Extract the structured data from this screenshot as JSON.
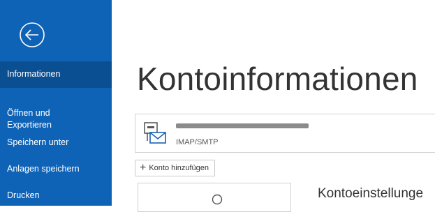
{
  "sidebar": {
    "back_icon": "back-arrow-circle-icon",
    "items": [
      {
        "label": "Informationen",
        "active": true
      },
      {
        "label": "Öffnen und\nExportieren",
        "active": false
      },
      {
        "label": "Speichern unter",
        "active": false
      },
      {
        "label": "Anlagen speichern",
        "active": false
      },
      {
        "label": "Drucken",
        "active": false
      }
    ]
  },
  "main": {
    "title": "Kontoinformationen",
    "account": {
      "type": "IMAP/SMTP",
      "icon": "mail-account-icon"
    },
    "add_account_label": "Konto hinzufügen",
    "settings_tile_icon": "search-icon",
    "settings_title": "Kontoeinstellunge"
  },
  "colors": {
    "sidebar": "#0f63b6",
    "sidebar_active": "#0b4f93",
    "icon_accent": "#1a5fb4"
  }
}
